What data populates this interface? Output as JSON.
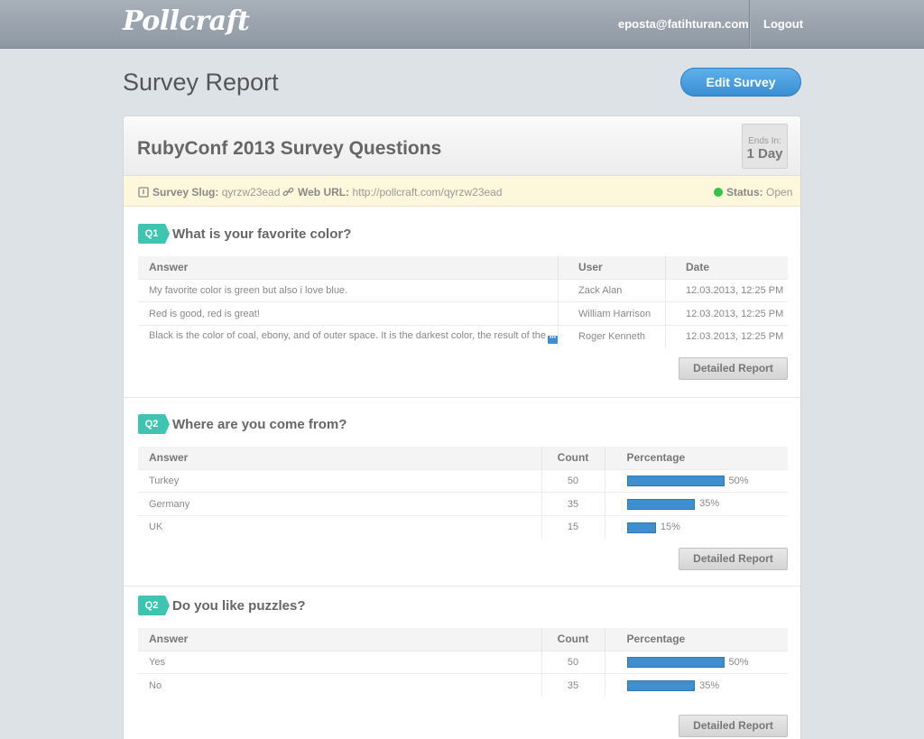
{
  "app": {
    "logo": "Pollcraft"
  },
  "nav": {
    "email": "eposta@fatihturan.com",
    "logout": "Logout"
  },
  "page": {
    "title": "Survey Report",
    "edit_button": "Edit Survey"
  },
  "survey": {
    "title": "RubyConf 2013 Survey Questions",
    "ends_label": "Ends In:",
    "ends_value": "1 Day",
    "slug_label": "Survey Slug:",
    "slug_value": "qyrzw23ead",
    "url_label": "Web URL:",
    "url_value": "http://pollcraft.com/qyrzw23ead",
    "status_label": "Status:",
    "status_value": "Open"
  },
  "questions": [
    {
      "tag": "Q1",
      "text": "What is your favorite color?",
      "headers": [
        "Answer",
        "User",
        "Date"
      ],
      "rows": [
        [
          "My favorite color is green but also i love blue.",
          "Zack Alan",
          "12.03.2013, 12:25 PM"
        ],
        [
          "Red is good, red is great!",
          "William Harrison",
          "12.03.2013, 12:25 PM"
        ],
        [
          "Black is the color of coal, ebony, and of outer space. It is the darkest color, the result of the",
          "Roger Kenneth",
          "12.03.2013, 12:25 PM"
        ]
      ],
      "detail_button": "Detailed Report"
    },
    {
      "tag": "Q2",
      "text": "Where are you come from?",
      "headers": [
        "Answer",
        "Count",
        "Percentage"
      ],
      "rows": [
        {
          "answer": "Turkey",
          "count": "50",
          "percent_label": "50%",
          "percent": 50
        },
        {
          "answer": "Germany",
          "count": "35",
          "percent_label": "35%",
          "percent": 35
        },
        {
          "answer": "UK",
          "count": "15",
          "percent_label": "15%",
          "percent": 15
        }
      ],
      "detail_button": "Detailed Report"
    },
    {
      "tag": "Q2",
      "text": "Do you like puzzles?",
      "headers": [
        "Answer",
        "Count",
        "Percentage"
      ],
      "rows": [
        {
          "answer": "Yes",
          "count": "50",
          "percent_label": "50%",
          "percent": 50
        },
        {
          "answer": "No",
          "count": "35",
          "percent_label": "35%",
          "percent": 35
        }
      ],
      "detail_button": "Detailed Report"
    }
  ]
}
